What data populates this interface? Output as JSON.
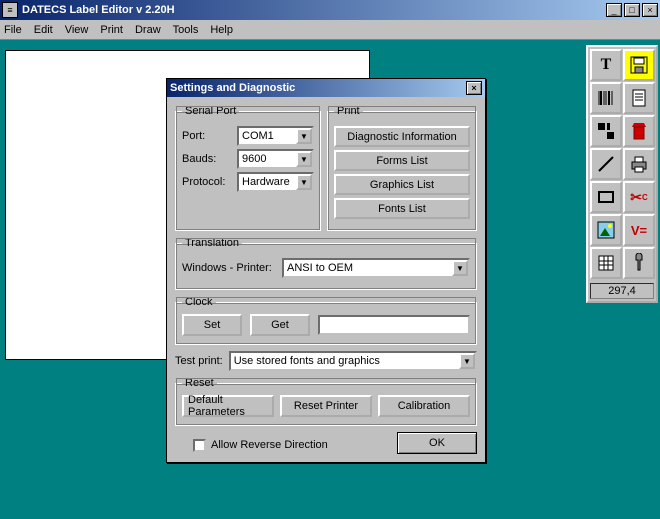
{
  "app": {
    "title": "DATECS Label Editor v 2.20H"
  },
  "menu": {
    "file": "File",
    "edit": "Edit",
    "view": "View",
    "print": "Print",
    "draw": "Draw",
    "tools": "Tools",
    "help": "Help"
  },
  "toolbox": {
    "coords": "297,4"
  },
  "dialog": {
    "title": "Settings and Diagnostic",
    "serial": {
      "legend": "Serial Port",
      "port_label": "Port:",
      "port_value": "COM1",
      "bauds_label": "Bauds:",
      "bauds_value": "9600",
      "protocol_label": "Protocol:",
      "protocol_value": "Hardware"
    },
    "print": {
      "legend": "Print",
      "diag": "Diagnostic Information",
      "forms": "Forms List",
      "graphics": "Graphics List",
      "fonts": "Fonts List"
    },
    "translation": {
      "legend": "Translation",
      "label": "Windows - Printer:",
      "value": "ANSI to OEM"
    },
    "clock": {
      "legend": "Clock",
      "set": "Set",
      "get": "Get",
      "value": ""
    },
    "testprint": {
      "label": "Test print:",
      "value": "Use stored fonts and graphics"
    },
    "reset": {
      "legend": "Reset",
      "defaults": "Default Parameters",
      "resetp": "Reset Printer",
      "calib": "Calibration"
    },
    "reverse": "Allow Reverse Direction",
    "ok": "OK"
  }
}
